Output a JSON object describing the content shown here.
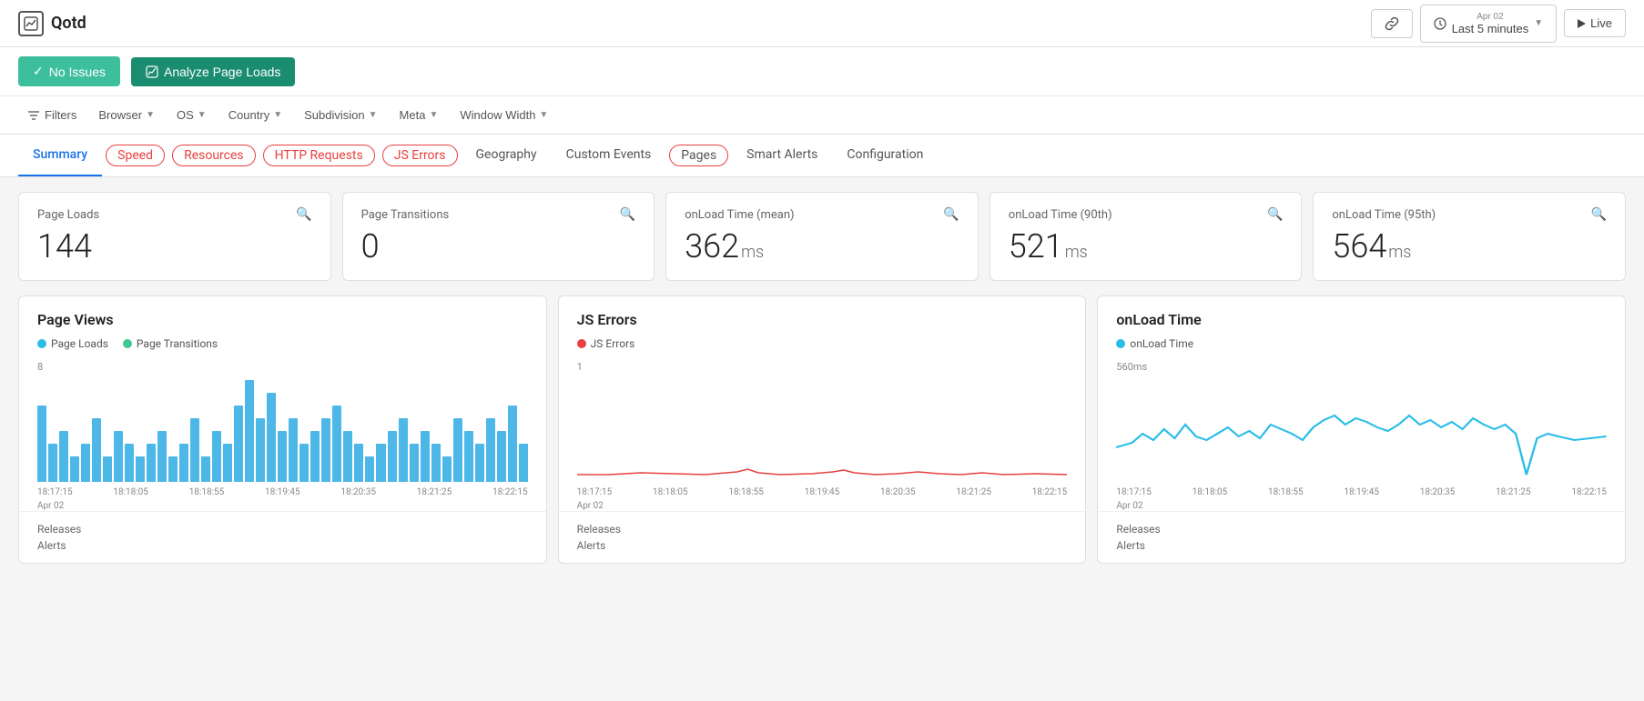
{
  "header": {
    "logo_text": "Qotd",
    "btn_link_label": "🔗",
    "btn_time_icon": "🕐",
    "btn_time_label": "Last 5 minutes",
    "btn_time_date": "Apr 02",
    "btn_live_label": "Live"
  },
  "action_bar": {
    "btn_no_issues": "No Issues",
    "btn_analyze": "Analyze Page Loads"
  },
  "filters": {
    "label": "Filters",
    "items": [
      "Browser",
      "OS",
      "Country",
      "Subdivision",
      "Meta",
      "Window Width"
    ]
  },
  "tabs": {
    "items": [
      {
        "label": "Summary",
        "active": true,
        "style": "normal"
      },
      {
        "label": "Speed",
        "active": false,
        "style": "circled"
      },
      {
        "label": "Resources",
        "active": false,
        "style": "circled"
      },
      {
        "label": "HTTP Requests",
        "active": false,
        "style": "circled"
      },
      {
        "label": "JS Errors",
        "active": false,
        "style": "circled"
      },
      {
        "label": "Geography",
        "active": false,
        "style": "normal"
      },
      {
        "label": "Custom Events",
        "active": false,
        "style": "normal"
      },
      {
        "label": "Pages",
        "active": false,
        "style": "circled-pages"
      },
      {
        "label": "Smart Alerts",
        "active": false,
        "style": "normal"
      },
      {
        "label": "Configuration",
        "active": false,
        "style": "normal"
      }
    ]
  },
  "metrics": [
    {
      "title": "Page Loads",
      "value": "144",
      "unit": "",
      "zoom": "⊕"
    },
    {
      "title": "Page Transitions",
      "value": "0",
      "unit": "",
      "zoom": "⊕"
    },
    {
      "title": "onLoad Time (mean)",
      "value": "362",
      "unit": "ms",
      "zoom": "⊕"
    },
    {
      "title": "onLoad Time (90th)",
      "value": "521",
      "unit": "ms",
      "zoom": "⊕"
    },
    {
      "title": "onLoad Time (95th)",
      "value": "564",
      "unit": "ms",
      "zoom": "⊕"
    }
  ],
  "charts": [
    {
      "id": "page-views",
      "title": "Page Views",
      "legend": [
        {
          "label": "Page Loads",
          "color": "#2bbde8"
        },
        {
          "label": "Page Transitions",
          "color": "#3ec98e"
        }
      ],
      "y_max": "8",
      "x_labels": [
        "18:17:15",
        "18:18:05",
        "18:18:55",
        "18:19:45",
        "18:20:35",
        "18:21:25",
        "18:22:15"
      ],
      "x_date": "Apr 02",
      "bars": [
        6,
        3,
        4,
        2,
        3,
        5,
        2,
        4,
        3,
        2,
        3,
        4,
        2,
        3,
        5,
        2,
        4,
        3,
        6,
        8,
        5,
        7,
        4,
        5,
        3,
        4,
        5,
        6,
        4,
        3,
        2,
        3,
        4,
        5,
        3,
        4,
        3,
        2,
        5,
        4,
        3,
        5,
        4,
        6,
        3
      ],
      "type": "bar",
      "footer": [
        "Releases",
        "Alerts"
      ]
    },
    {
      "id": "js-errors",
      "title": "JS Errors",
      "legend": [
        {
          "label": "JS Errors",
          "color": "#e84040"
        }
      ],
      "y_max": "1",
      "x_labels": [
        "18:17:15",
        "18:18:05",
        "18:18:55",
        "18:19:45",
        "18:20:35",
        "18:21:25",
        "18:22:15"
      ],
      "x_date": "Apr 02",
      "type": "line-flat",
      "footer": [
        "Releases",
        "Alerts"
      ]
    },
    {
      "id": "onload-time",
      "title": "onLoad Time",
      "legend": [
        {
          "label": "onLoad Time",
          "color": "#2bbde8"
        }
      ],
      "y_max": "560ms",
      "x_labels": [
        "18:17:15",
        "18:18:05",
        "18:18:55",
        "18:19:45",
        "18:20:35",
        "18:21:25",
        "18:22:15"
      ],
      "x_date": "Apr 02",
      "type": "line-wave",
      "footer": [
        "Releases",
        "Alerts"
      ]
    }
  ]
}
